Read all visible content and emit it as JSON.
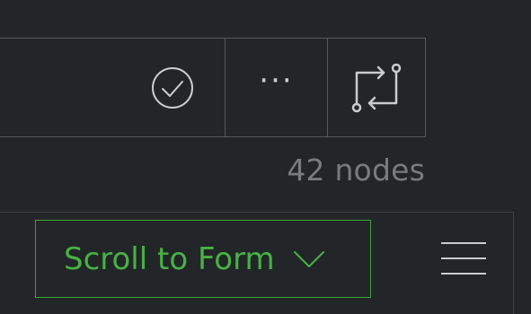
{
  "toolbar": {
    "check_icon": "check-circle-icon",
    "more_label": "···",
    "swap_icon": "swap-arrows-icon"
  },
  "status": {
    "node_count": "42 nodes"
  },
  "bottom": {
    "scroll_button_label": "Scroll to Form",
    "chevron_icon": "chevron-down-icon",
    "menu_icon": "hamburger-menu-icon"
  },
  "colors": {
    "background": "#232628",
    "accent_green": "#46b243",
    "border": "#55595d",
    "muted_text": "#777c80"
  }
}
